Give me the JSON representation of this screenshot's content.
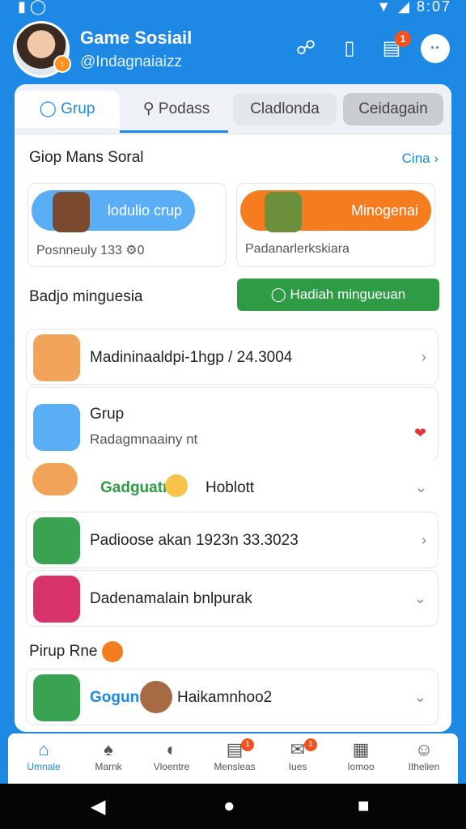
{
  "status": {
    "time": "8:07"
  },
  "header": {
    "title": "Game Sosiail",
    "handle": "@Indagnaiaizz",
    "notif_count": "1"
  },
  "tabs": [
    {
      "label": "Grup"
    },
    {
      "label": "Podass"
    },
    {
      "label": "Cladlonda"
    },
    {
      "label": "Ceidagain"
    }
  ],
  "section1": {
    "title": "Giop Mans Soral",
    "see_all": "Cina"
  },
  "cards": [
    {
      "button": "lodulio crup",
      "sub": "Posnneuly 133",
      "sub2": "0",
      "color": "#5aaef5"
    },
    {
      "button": "Minogenai",
      "sub": "Padanarlerkskiara",
      "color": "#f57c1f"
    }
  ],
  "section2": {
    "title": "Badjo minguesia",
    "action": "Hadiah mingueuan"
  },
  "rows": [
    {
      "text": "Madininaaldpi-1hgp / 24.3004"
    },
    {
      "title": "Grup",
      "sub": "Radagmnaainy nt"
    },
    {
      "text": "Gadguatr",
      "text2": "Hoblott"
    },
    {
      "text": "Padioose akan 1923n 33.3023"
    },
    {
      "text": "Dadenamalain bnlpurak"
    }
  ],
  "section3": {
    "title": "Pirup Rne"
  },
  "last_row": {
    "text": "Gogun",
    "text2": "Haikamnhoo2"
  },
  "nav": [
    {
      "label": "Umnale",
      "icon": "home-icon"
    },
    {
      "label": "Marnk",
      "icon": "profile-icon"
    },
    {
      "label": "Vloentre",
      "icon": "gauge-icon"
    },
    {
      "label": "Mensleas",
      "icon": "message-icon",
      "badge": "1"
    },
    {
      "label": "Iues",
      "icon": "mail-icon",
      "badge": "1"
    },
    {
      "label": "Iomoo",
      "icon": "document-icon"
    },
    {
      "label": "Ithelien",
      "icon": "person-icon"
    }
  ]
}
